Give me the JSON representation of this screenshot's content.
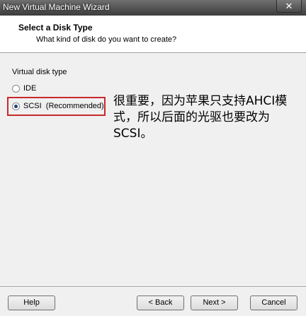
{
  "window": {
    "title": "New Virtual Machine Wizard",
    "close_glyph": "✕"
  },
  "header": {
    "title": "Select a Disk Type",
    "subtitle": "What kind of disk do you want to create?"
  },
  "disk_type": {
    "group_label": "Virtual disk type",
    "options": [
      {
        "label": "IDE",
        "selected": false
      },
      {
        "label": "SCSI  (Recommended)",
        "selected": true
      }
    ]
  },
  "annotation": {
    "text": "很重要，因为苹果只支持AHCI模式，所以后面的光驱也要改为SCSI。",
    "color": "#c8282d"
  },
  "buttons": {
    "help": "Help",
    "back": "< Back",
    "next": "Next >",
    "cancel": "Cancel"
  }
}
